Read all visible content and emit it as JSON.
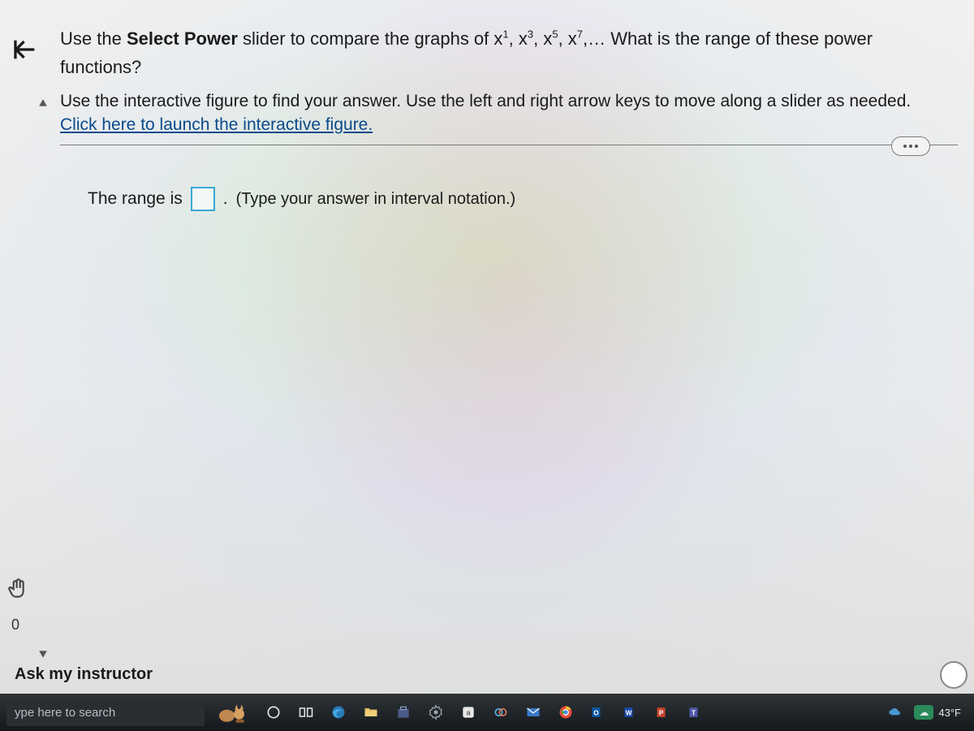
{
  "question": {
    "prefix": "Use the ",
    "bold": "Select Power",
    "after_bold": " slider to compare the graphs of x",
    "powers": [
      "1",
      "3",
      "5",
      "7"
    ],
    "after_powers": ",… What is the range of these power functions?"
  },
  "instructions": {
    "line1": "Use the interactive figure to find your answer. Use the left and right arrow keys to move along a slider as needed.",
    "link": "Click here to launch the interactive figure."
  },
  "answer": {
    "label_before": "The range is",
    "hint": "(Type your answer in interval notation.)"
  },
  "sidebar": {
    "zero": "0"
  },
  "footer": {
    "ask": "Ask my instructor"
  },
  "taskbar": {
    "search_placeholder": "ype here to search",
    "temperature": "43°F"
  }
}
